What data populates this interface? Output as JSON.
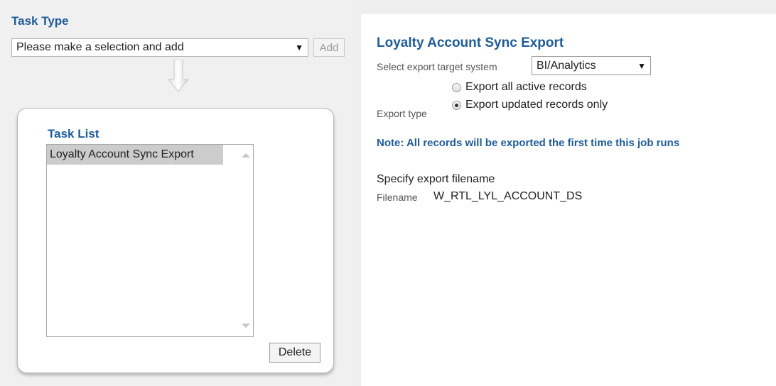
{
  "task_type": {
    "title": "Task Type",
    "select_value": "Please make a selection and add",
    "add_label": "Add"
  },
  "task_list": {
    "title": "Task List",
    "items": [
      {
        "label": "Loyalty Account Sync Export",
        "selected": true
      }
    ],
    "delete_label": "Delete"
  },
  "export": {
    "title": "Loyalty Account Sync Export",
    "target_label": "Select export target system",
    "target_value": "BI/Analytics",
    "export_type_label": "Export type",
    "options": [
      {
        "label": "Export all active records",
        "checked": false
      },
      {
        "label": "Export updated records only",
        "checked": true
      }
    ],
    "note": "Note: All records will be exported the first time this job runs",
    "filename_heading": "Specify export filename",
    "filename_label": "Filename",
    "filename_value": "W_RTL_LYL_ACCOUNT_DS"
  },
  "colors": {
    "heading_blue": "#1f5c99",
    "panel_bg": "#f0f0f0",
    "selected_item_bg": "#cccccc"
  },
  "icons": {
    "dropdown_caret": "▼",
    "flow_arrow": "arrow-down-icon"
  }
}
